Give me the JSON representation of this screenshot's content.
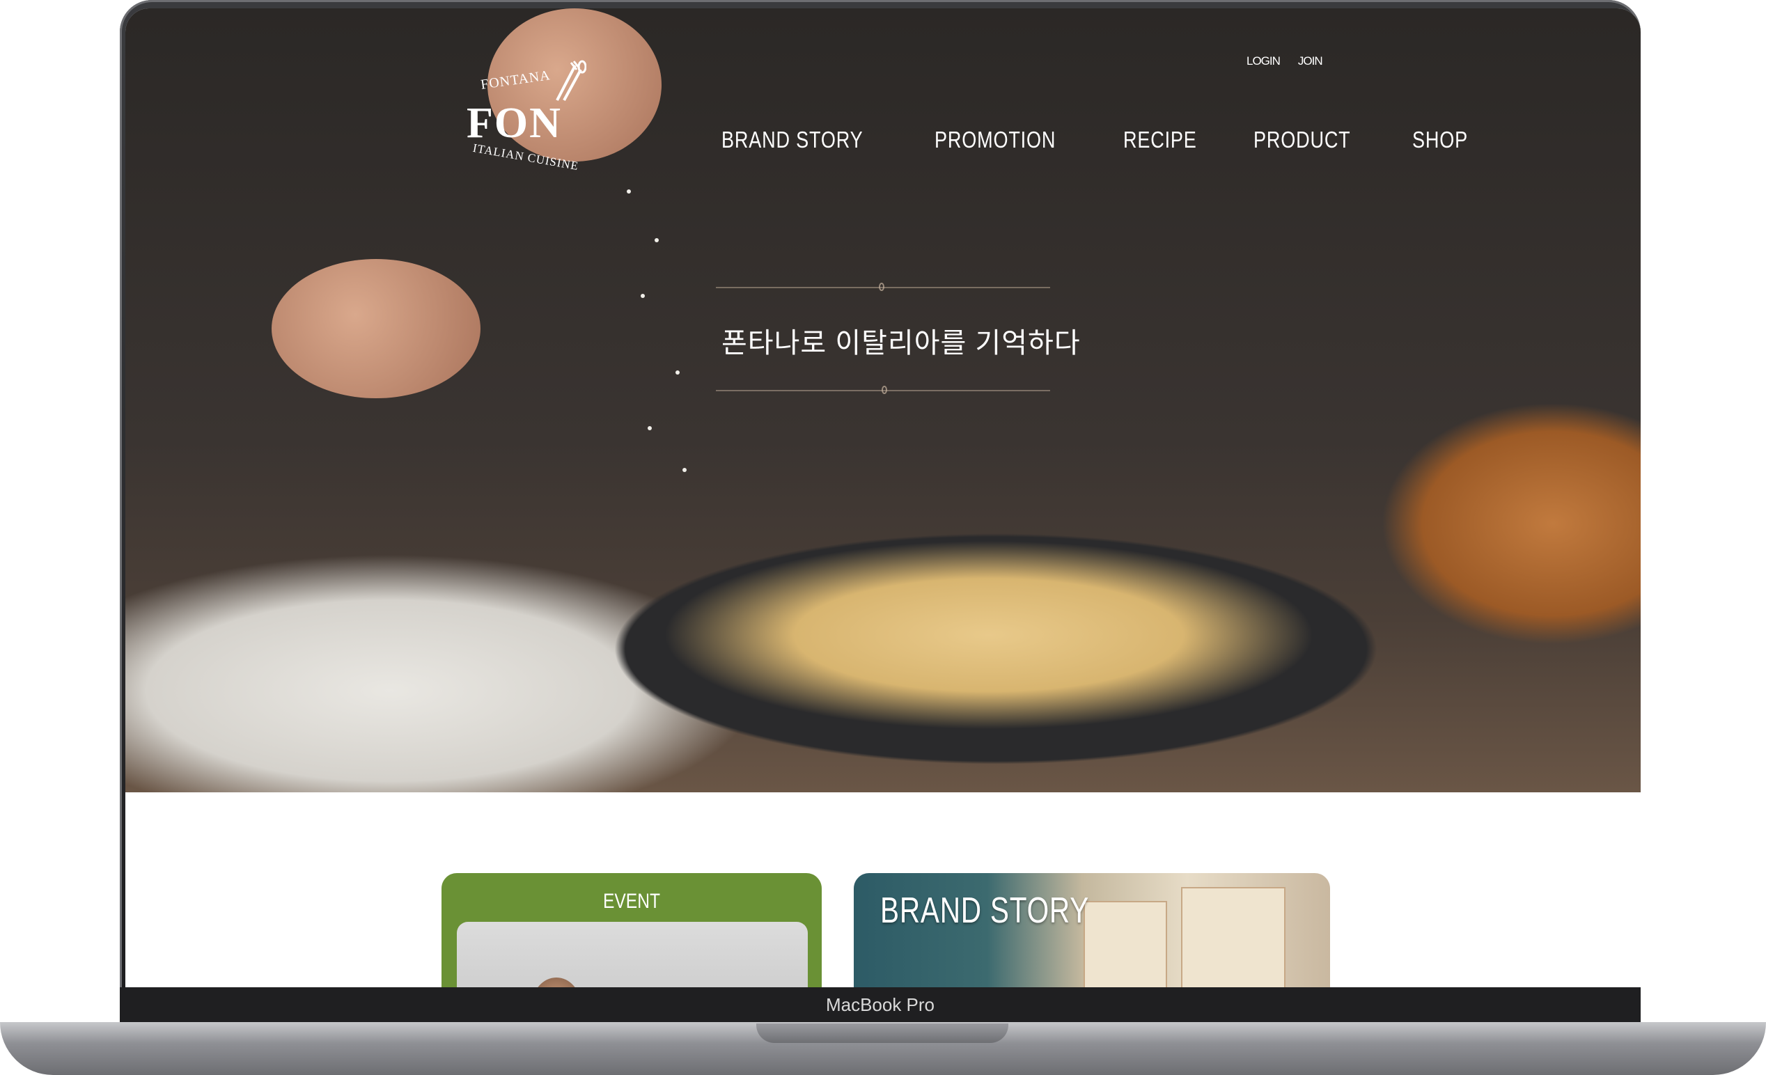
{
  "device": {
    "model_label": "MacBook Pro"
  },
  "site": {
    "logo": {
      "top": "FONTANA",
      "main": "FON",
      "bottom": "ITALIAN CUISINE"
    },
    "utility_links": [
      "LOGIN",
      "JOIN"
    ],
    "nav": [
      "BRAND STORY",
      "PROMOTION",
      "RECIPE",
      "PRODUCT",
      "SHOP"
    ],
    "hero": {
      "tagline": "폰타나로 이탈리아를 기억하다"
    },
    "cards": {
      "event": {
        "label": "EVENT"
      },
      "brand": {
        "label": "BRAND STORY"
      }
    }
  },
  "colors": {
    "event_green": "#6a9135",
    "bezel": "#1f1f21"
  },
  "icons": [
    "fork-spoon-icon"
  ]
}
